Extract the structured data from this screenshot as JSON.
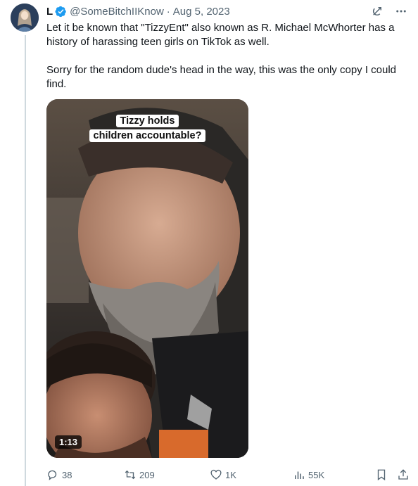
{
  "tweet": {
    "name": "L",
    "handle": "@SomeBitchIIKnow",
    "separator": "·",
    "date": "Aug 5, 2023",
    "paragraphs": [
      "Let it be known that \"TizzyEnt\" also known as R. Michael McWhorter has a history of harassing teen girls on TikTok as well.",
      "Sorry for the random dude's head in the way, this was the only copy I could find."
    ]
  },
  "video": {
    "caption_line1": "Tizzy holds",
    "caption_line2": "children accountable?",
    "duration": "1:13"
  },
  "actions": {
    "replies": "38",
    "reposts": "209",
    "likes": "1K",
    "views": "55K"
  },
  "colors": {
    "text": "#0f1419",
    "secondary": "#536471",
    "verified": "#1d9bf0",
    "divider": "#cfd9de"
  },
  "icons": {
    "verified": "verified-badge-icon",
    "grok": "grok-icon",
    "more": "more-icon",
    "reply": "reply-icon",
    "repost": "repost-icon",
    "like": "heart-icon",
    "views": "views-icon",
    "bookmark": "bookmark-icon",
    "share": "share-icon"
  }
}
